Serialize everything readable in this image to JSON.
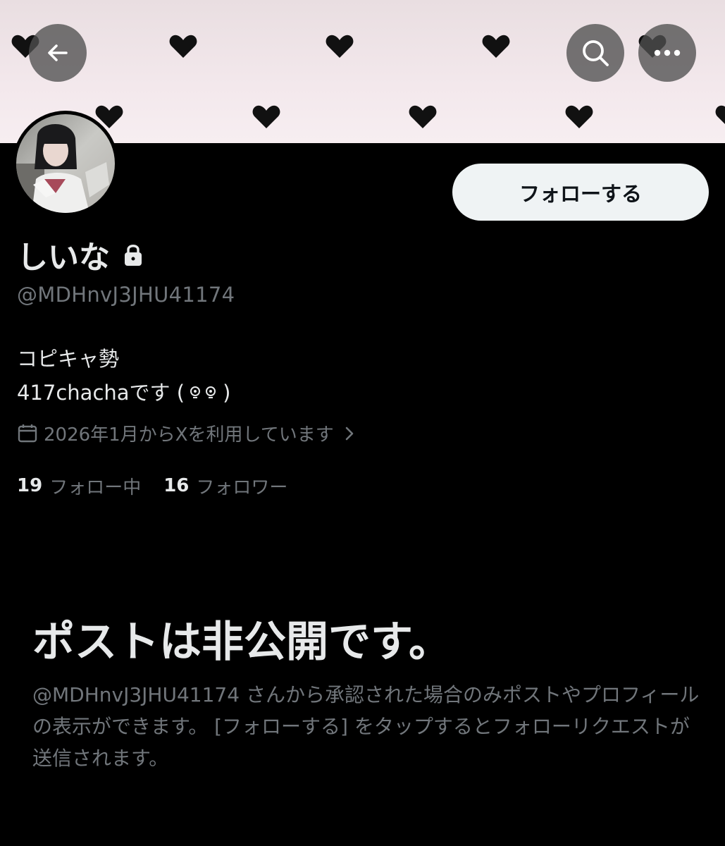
{
  "header": {
    "back_icon": "arrow-left-icon",
    "search_icon": "search-icon",
    "more_icon": "more-horizontal-icon",
    "banner_pattern": "black-hearts-on-pink"
  },
  "profile": {
    "display_name": "しいな",
    "handle": "@MDHnvJ3JHU41174",
    "follow_button": "フォローする",
    "bio_line1": "コピキャ勢",
    "bio_line2_text": "417chachaです (",
    "bio_line2_end": ")",
    "joined": "2026年1月からXを利用しています",
    "following_count": "19",
    "following_label": "フォロー中",
    "followers_count": "16",
    "followers_label": "フォロワー"
  },
  "private_notice": {
    "title": "ポストは非公開です。",
    "description": "@MDHnvJ3JHU41174 さんから承認された場合のみポストやプロフィールの表示ができます。 [フォローする] をタップするとフォローリクエストが送信されます。"
  },
  "colors": {
    "background": "#000000",
    "text_primary": "#e7e9ea",
    "text_secondary": "#71767b",
    "button_bg": "#eff3f4",
    "banner_pink": "#f3e8ec"
  }
}
